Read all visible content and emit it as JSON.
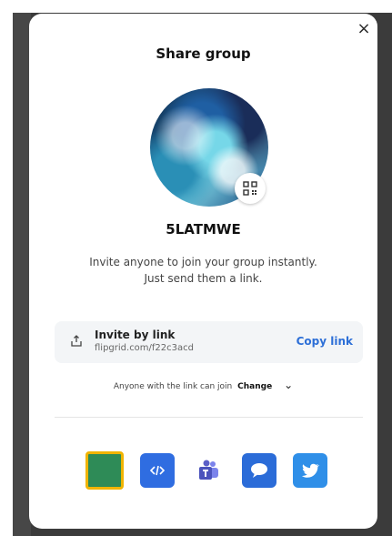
{
  "modal": {
    "title": "Share group",
    "close_glyph": "×",
    "group_code": "5LATMWE",
    "description_line1": "Invite anyone to join your group instantly.",
    "description_line2": "Just send them a link."
  },
  "invite": {
    "label": "Invite by link",
    "link": "flipgrid.com/f22c3acd",
    "copy_label": "Copy link"
  },
  "access": {
    "text": "Anyone with the link can join",
    "change_label": "Change",
    "chevron": "⌄"
  },
  "share_targets": [
    {
      "name": "classroom-share-icon",
      "color": "#2e8b57"
    },
    {
      "name": "embed-code-icon",
      "color": "#2f6de1"
    },
    {
      "name": "microsoft-teams-icon",
      "color": "#6264a7"
    },
    {
      "name": "webex-chat-icon",
      "color": "#2b6cd8"
    },
    {
      "name": "twitter-icon",
      "color": "#2f8fe8"
    }
  ],
  "colors": {
    "link_blue": "#2d6fd7",
    "backdrop": "#3b3b3b"
  }
}
